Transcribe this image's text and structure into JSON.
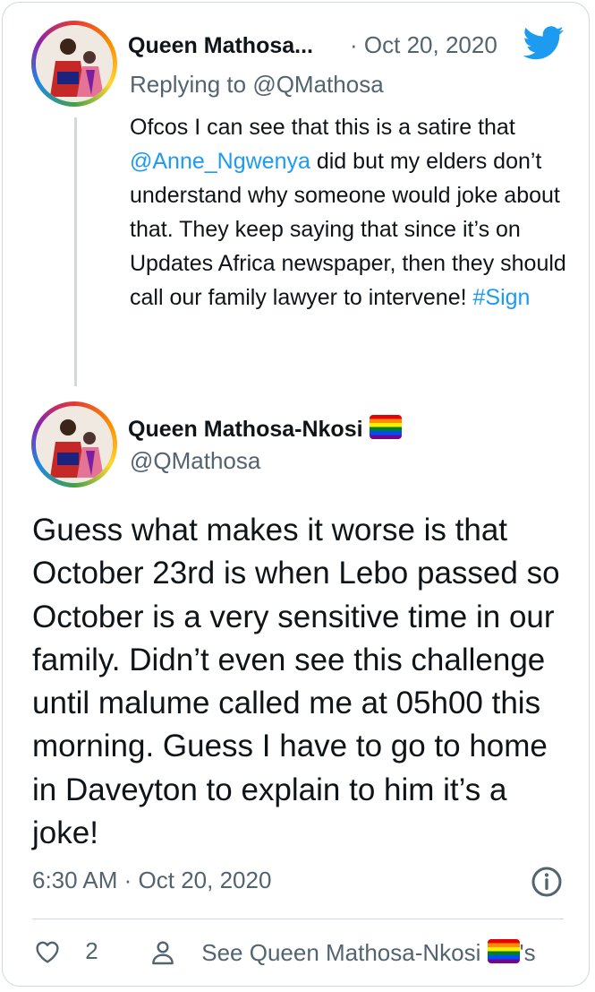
{
  "colors": {
    "accent": "#1d9bf0",
    "muted": "#536471",
    "text": "#0f1419",
    "border": "#cfd9de"
  },
  "reply_tweet": {
    "author_name": "Queen Mathosa...",
    "separator": "·",
    "date": "Oct 20, 2020",
    "replying_to_label": "Replying to",
    "replying_to_handle": "@QMathosa",
    "text_part1": "Ofcos I can see that this is a satire that ",
    "mention": "@Anne_Ngwenya",
    "text_part2": " did but my elders don’t understand why someone would joke about that. They keep saying that since it’s on Updates Africa newspaper, then they should call our family lawyer to intervene! ",
    "hashtag": "#Sign",
    "avatar_icon": "profile-photo",
    "logo_icon": "twitter-bird-icon"
  },
  "main_tweet": {
    "author_name": "Queen Mathosa-Nkosi",
    "author_flag_icon": "rainbow-flag-icon",
    "handle": "@QMathosa",
    "text": "Guess what makes it worse is that October 23rd is when Lebo passed so October is a very sensitive time in our family. Didn’t even see this challenge until malume called me at 05h00 this morning. Guess I have to go to home in Daveyton to explain to him it’s a joke!",
    "time": "6:30 AM",
    "separator": "·",
    "date": "Oct 20, 2020",
    "info_icon": "info-icon"
  },
  "actions": {
    "like_icon": "heart-icon",
    "like_count": "2",
    "profile_icon": "person-icon",
    "see_profile_label": "See Queen Mathosa-Nkosi",
    "see_profile_suffix": "'s"
  }
}
